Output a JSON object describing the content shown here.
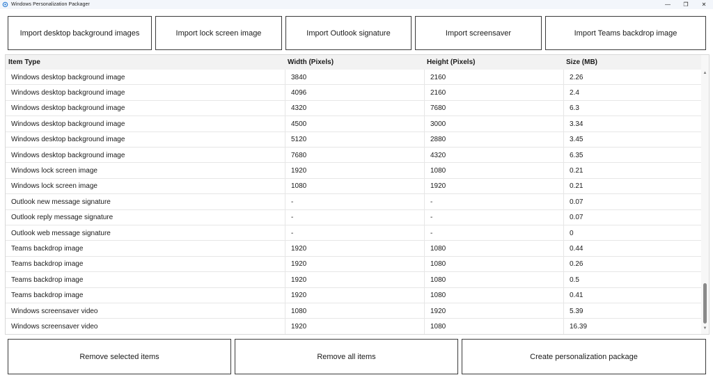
{
  "window": {
    "title": "Windows Personalization Packager",
    "controls": {
      "minimize": "—",
      "restore": "❐",
      "close": "✕"
    }
  },
  "top_buttons": [
    {
      "label": "Import desktop background images"
    },
    {
      "label": "Import lock screen image"
    },
    {
      "label": "Import Outlook signature"
    },
    {
      "label": "Import screensaver"
    },
    {
      "label": "Import Teams backdrop image"
    }
  ],
  "table": {
    "columns": [
      "Item Type",
      "Width (Pixels)",
      "Height (Pixels)",
      "Size (MB)"
    ],
    "rows": [
      [
        "Windows desktop background image",
        "3840",
        "2160",
        "2.26"
      ],
      [
        "Windows desktop background image",
        "4096",
        "2160",
        "2.4"
      ],
      [
        "Windows desktop background image",
        "4320",
        "7680",
        "6.3"
      ],
      [
        "Windows desktop background image",
        "4500",
        "3000",
        "3.34"
      ],
      [
        "Windows desktop background image",
        "5120",
        "2880",
        "3.45"
      ],
      [
        "Windows desktop background image",
        "7680",
        "4320",
        "6.35"
      ],
      [
        "Windows lock screen image",
        "1920",
        "1080",
        "0.21"
      ],
      [
        "Windows lock screen image",
        "1080",
        "1920",
        "0.21"
      ],
      [
        "Outlook new message signature",
        "-",
        "-",
        "0.07"
      ],
      [
        "Outlook reply message signature",
        "-",
        "-",
        "0.07"
      ],
      [
        "Outlook web message signature",
        "-",
        "-",
        "0"
      ],
      [
        "Teams backdrop image",
        "1920",
        "1080",
        "0.44"
      ],
      [
        "Teams backdrop image",
        "1920",
        "1080",
        "0.26"
      ],
      [
        "Teams backdrop image",
        "1920",
        "1080",
        "0.5"
      ],
      [
        "Teams backdrop image",
        "1920",
        "1080",
        "0.41"
      ],
      [
        "Windows screensaver video",
        "1080",
        "1920",
        "5.39"
      ],
      [
        "Windows screensaver video",
        "1920",
        "1080",
        "16.39"
      ]
    ]
  },
  "scrollbar": {
    "up_arrow": "▲",
    "down_arrow": "▼"
  },
  "bottom_buttons": [
    {
      "label": "Remove selected items"
    },
    {
      "label": "Remove all items"
    },
    {
      "label": "Create personalization package"
    }
  ]
}
